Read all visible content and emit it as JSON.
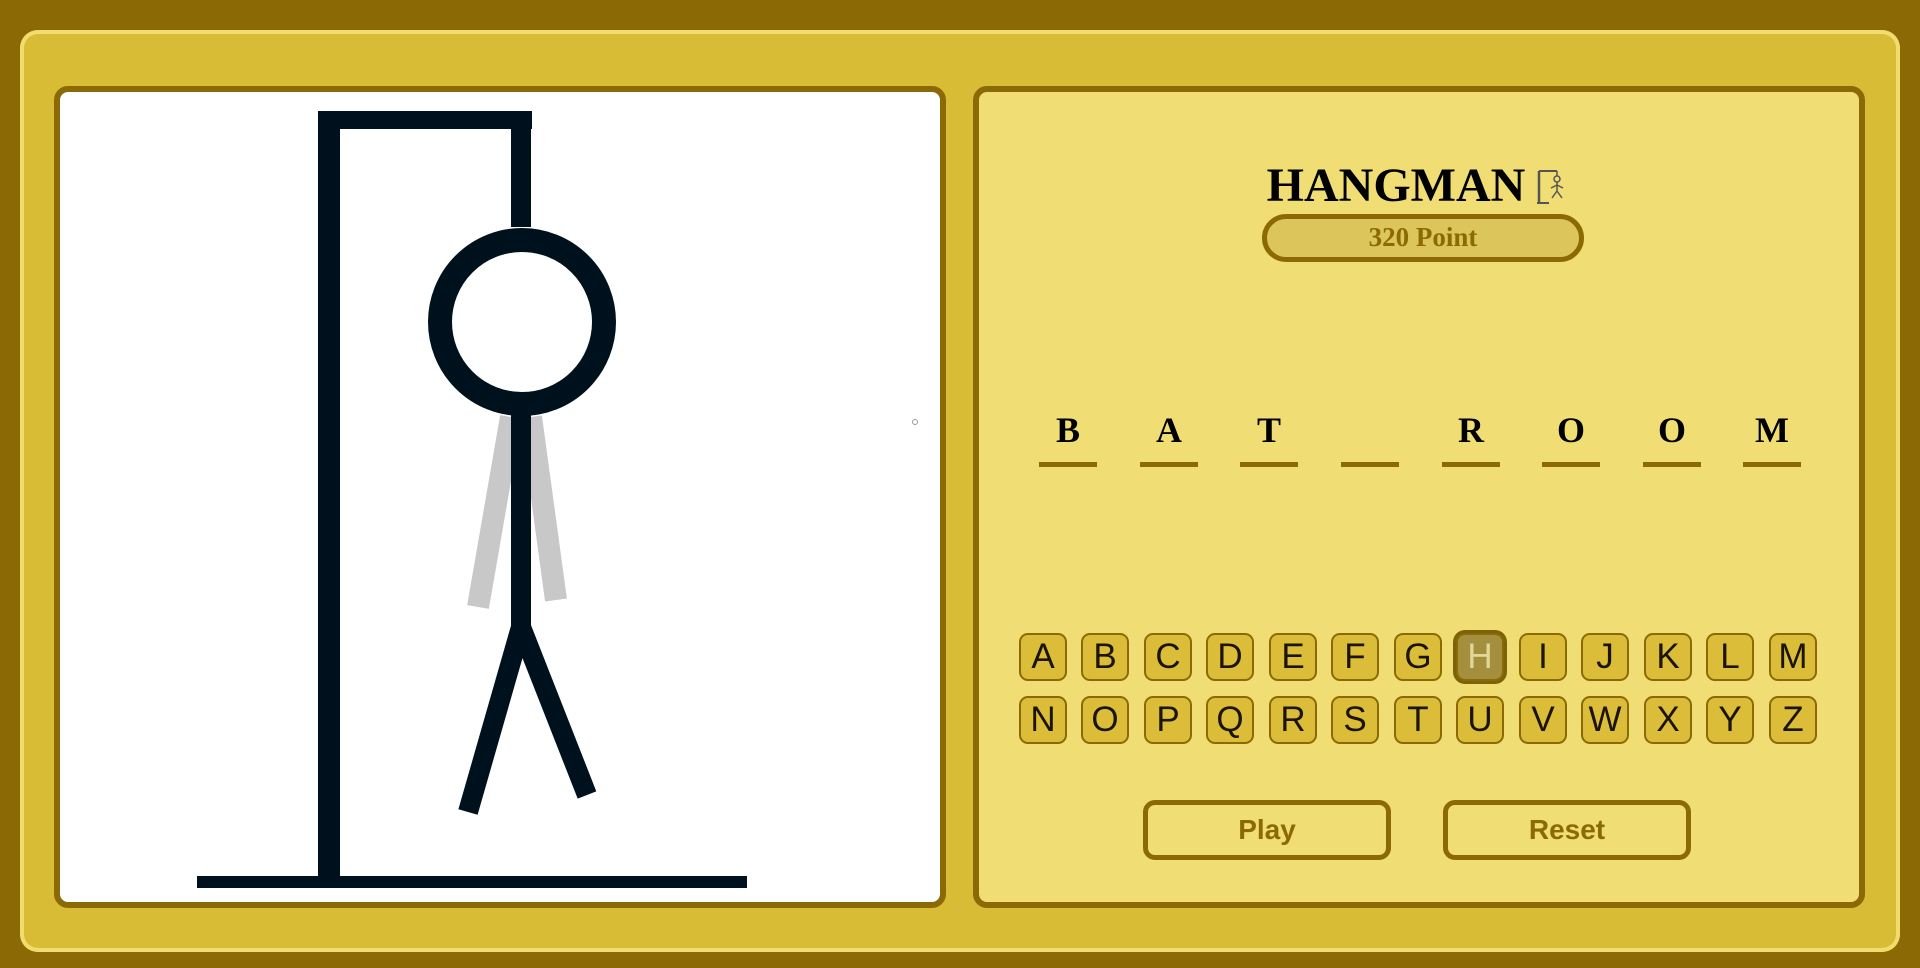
{
  "game": {
    "title": "HANGMAN",
    "title_icon": "gallows-icon",
    "score_label": "320 Point"
  },
  "word": {
    "letters": [
      "B",
      "A",
      "T",
      "",
      "R",
      "O",
      "O",
      "M"
    ]
  },
  "keyboard": {
    "row1": [
      "A",
      "B",
      "C",
      "D",
      "E",
      "F",
      "G",
      "H",
      "I",
      "J",
      "K",
      "L",
      "M"
    ],
    "row2": [
      "N",
      "O",
      "P",
      "Q",
      "R",
      "S",
      "T",
      "U",
      "V",
      "W",
      "X",
      "Y",
      "Z"
    ],
    "used_letters": [
      "H"
    ]
  },
  "buttons": {
    "play_label": "Play",
    "reset_label": "Reset"
  },
  "drawing": {
    "visible_parts": [
      "base",
      "pole",
      "beam",
      "rope",
      "head",
      "body",
      "left-leg",
      "right-leg"
    ],
    "faded_parts": [
      "left-arm",
      "right-arm"
    ]
  },
  "colors": {
    "outer_border": "#8b6a05",
    "frame": "#d9bc35",
    "panel": "#f0dd74",
    "ink": "#00111e",
    "faded_part": "#c8c8c8"
  }
}
